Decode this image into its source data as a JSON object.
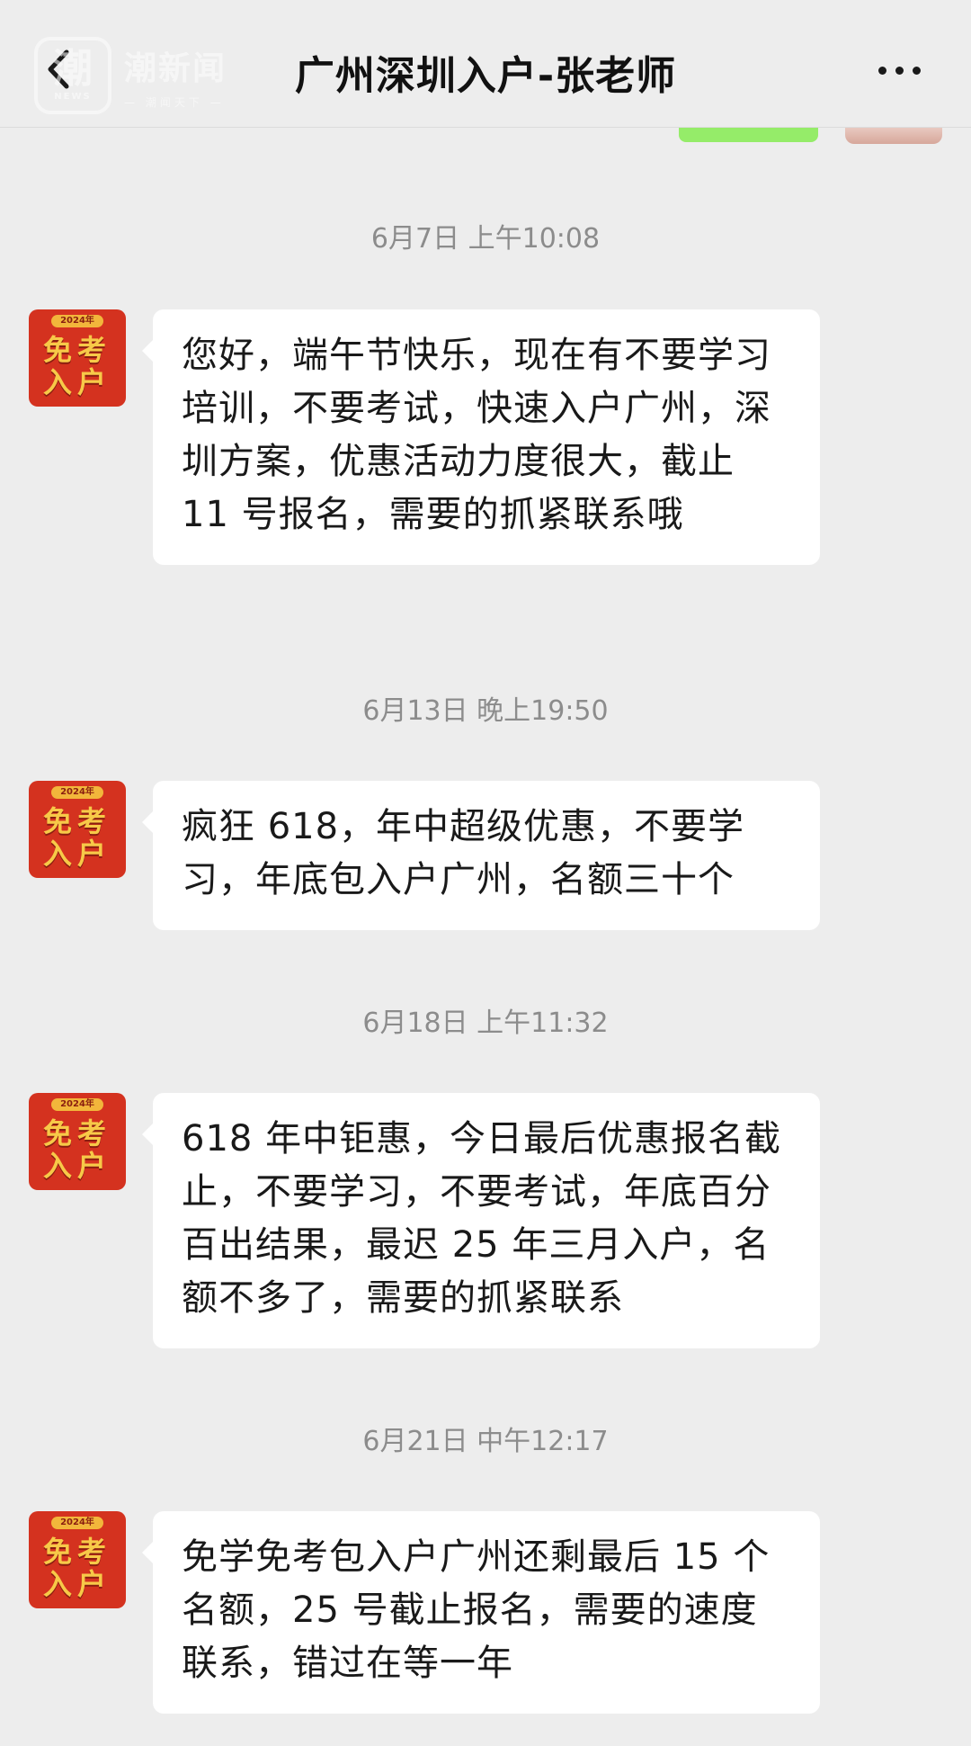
{
  "header": {
    "title": "广州深圳入户-张老师",
    "back_icon": "chevron-left-icon",
    "more_icon": "more-dots-icon"
  },
  "watermark": {
    "logo_char": "潮",
    "logo_sub": "NEWS",
    "name": "潮新闻",
    "slogan": "— 潮闻天下 —"
  },
  "contact_avatar": {
    "year": "2024年",
    "line1": "免考",
    "line2": "入户"
  },
  "messages": [
    {
      "time": "6月7日 上午10:08",
      "text": "您好，端午节快乐，现在有不要学习培训，不要考试，快速入户广州，深圳方案，优惠活动力度很大，截止 11 号报名，需要的抓紧联系哦"
    },
    {
      "time": "6月13日 晚上19:50",
      "text": "疯狂 618，年中超级优惠，不要学习，年底包入户广州，名额三十个"
    },
    {
      "time": "6月18日 上午11:32",
      "text": "618 年中钜惠，今日最后优惠报名截止，不要学习，不要考试，年底百分百出结果，最迟 25 年三月入户，名额不多了，需要的抓紧联系"
    },
    {
      "time": "6月21日 中午12:17",
      "text": "免学免考包入户广州还剩最后 15 个名额，25 号截止报名，需要的速度联系，错过在等一年"
    }
  ],
  "colors": {
    "background": "#ededed",
    "bubble": "#ffffff",
    "self_bubble": "#95ec69",
    "avatar_red": "#d4321f",
    "avatar_gold": "#f7c948",
    "timestamp": "#8c8c8c"
  }
}
